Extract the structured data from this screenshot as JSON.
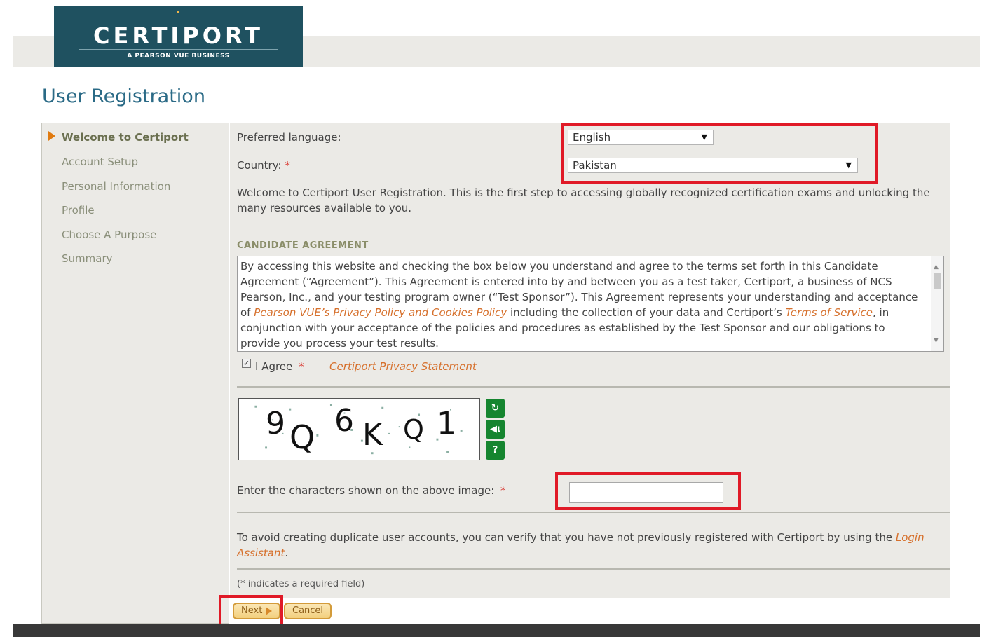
{
  "brand": {
    "logo_word": "CERTIPORT",
    "logo_tagline": "A PEARSON VUE BUSINESS"
  },
  "page": {
    "title": "User Registration"
  },
  "sidebar": {
    "items": [
      {
        "label": "Welcome to Certiport",
        "active": true
      },
      {
        "label": "Account Setup",
        "active": false
      },
      {
        "label": "Personal Information",
        "active": false
      },
      {
        "label": "Profile",
        "active": false
      },
      {
        "label": "Choose A Purpose",
        "active": false
      },
      {
        "label": "Summary",
        "active": false
      }
    ]
  },
  "form": {
    "language_label": "Preferred language:",
    "language_value": "English",
    "country_label": "Country:",
    "country_value": "Pakistan",
    "required_mark": "*",
    "welcome_text": "Welcome to Certiport User Registration. This is the first step to accessing globally recognized certification exams and unlocking the many resources available to you.",
    "agreement_heading": "CANDIDATE AGREEMENT",
    "agreement_text_1": "By accessing this website and checking the box below you understand and agree to the terms set forth in this Candidate Agreement (“Agreement”). This Agreement is entered into by and between you as a test taker, Certiport, a business of NCS Pearson, Inc., and your testing program owner (“Test Sponsor”). This Agreement represents your understanding and acceptance of ",
    "agreement_link_1": "Pearson VUE’s Privacy Policy and Cookies Policy",
    "agreement_text_2": " including the collection of your data and Certiport’s ",
    "agreement_link_2": "Terms of Service",
    "agreement_text_3": ", in conjunction with your acceptance of the policies and procedures as established by the Test Sponsor and our obligations to provide you process your test results.",
    "agree_label": "I Agree",
    "agree_checked": true,
    "privacy_link": "Certiport Privacy Statement",
    "captcha_chars": [
      "9",
      "Q",
      "6",
      "K",
      "Q",
      "1"
    ],
    "captcha_label": "Enter the characters shown on the above image:",
    "captcha_value": "",
    "duplicate_text": "To avoid creating duplicate user accounts, you can verify that you have not previously registered with Certiport by using the ",
    "login_assistant_link": "Login Assistant",
    "duplicate_end": ".",
    "required_note": "(* indicates a required field)"
  },
  "buttons": {
    "next": "Next",
    "cancel": "Cancel"
  },
  "icons": {
    "refresh": "refresh-icon",
    "audio": "speaker-icon",
    "help": "help-icon"
  },
  "colors": {
    "brand_teal": "#1f5160",
    "title_blue": "#2a6a86",
    "link_orange": "#d6702c",
    "highlight_red": "#e01a27",
    "captcha_green": "#15852f"
  }
}
